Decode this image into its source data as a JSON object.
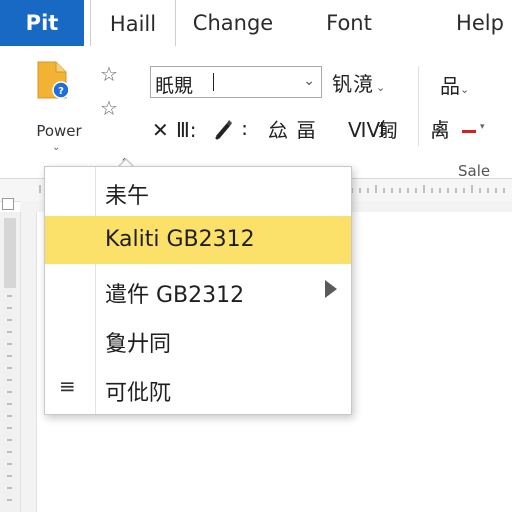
{
  "tabs": {
    "brand": "Pit",
    "items": [
      "Haill",
      "Change",
      "Font",
      "Help"
    ],
    "active": "Haill"
  },
  "ribbon": {
    "power_label": "Power",
    "font_box_value": "眂覞",
    "font_size_label": "钒滰",
    "row2": [
      "✕",
      "Ⅲ:",
      "∶",
      "厽",
      "畐",
      "ⅥⅥ",
      "匑",
      "禼"
    ],
    "group_icon": "品",
    "group_label": "Sale"
  },
  "menu": {
    "items": [
      {
        "label": "耒午",
        "highlighted": false,
        "submenu": false,
        "icon": ""
      },
      {
        "label": "Kaliti GB2312",
        "highlighted": true,
        "submenu": false,
        "icon": ""
      },
      {
        "label": "遣仵 GB2312",
        "highlighted": false,
        "submenu": true,
        "icon": ""
      },
      {
        "label": "敻廾同",
        "highlighted": false,
        "submenu": false,
        "icon": ""
      },
      {
        "label": "可仳阢",
        "highlighted": false,
        "submenu": false,
        "icon": "≡"
      }
    ]
  },
  "colors": {
    "brand": "#1769c4",
    "highlight": "#fbe06a",
    "accent_red": "#d32020",
    "doc_icon_orange": "#f2b233",
    "doc_icon_blue": "#1e6fd9"
  }
}
